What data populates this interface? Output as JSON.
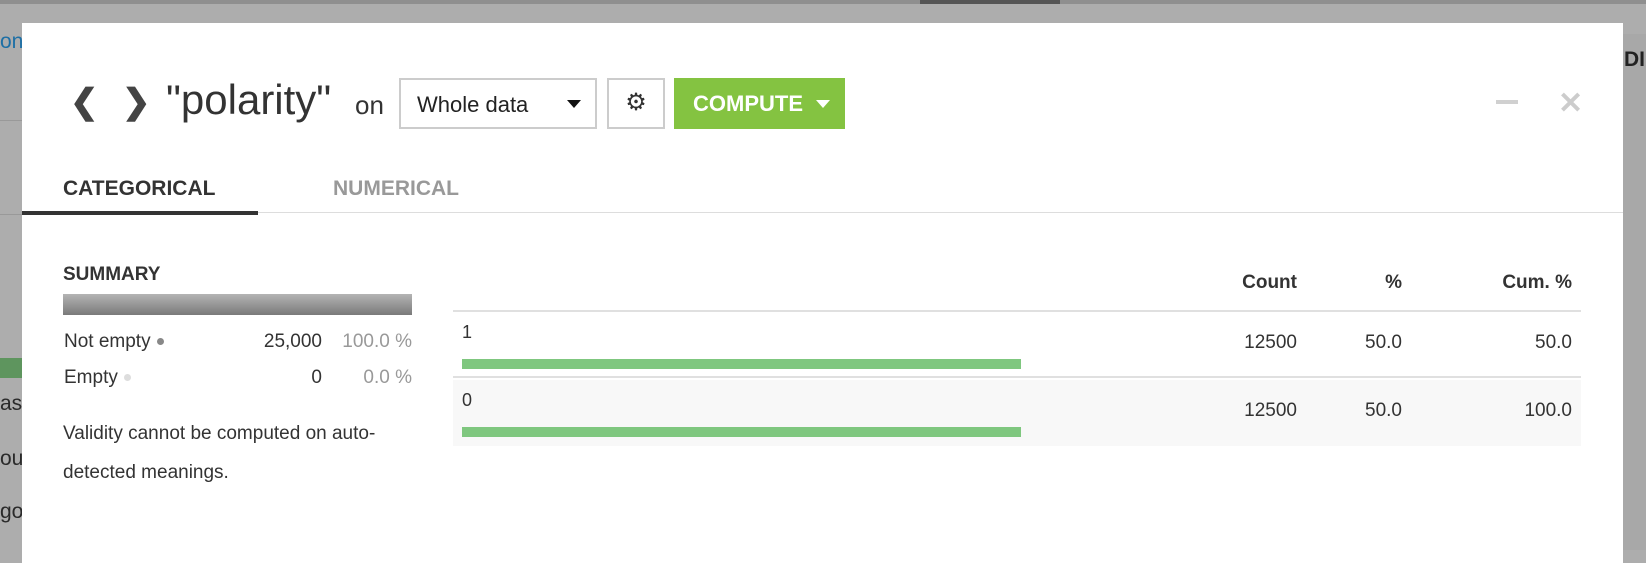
{
  "background": {
    "left_fragments": [
      "onf",
      "as",
      "ou",
      "go"
    ],
    "right_fragment": "DI"
  },
  "header": {
    "prev_icon": "chevron-left-icon",
    "next_icon": "chevron-right-icon",
    "column_title": "\"polarity\"",
    "on_label": "on",
    "sample_select": "Whole data",
    "settings_icon": "gear-icon",
    "compute_label": "COMPUTE",
    "minimize_icon": "minus-icon",
    "close_icon": "close-icon"
  },
  "tabs": [
    {
      "label": "CATEGORICAL",
      "active": true
    },
    {
      "label": "NUMERICAL",
      "active": false
    }
  ],
  "summary": {
    "title": "SUMMARY",
    "rows": [
      {
        "label": "Not empty",
        "value": "25,000",
        "pct": "100.0 %",
        "dot_color": "#888888"
      },
      {
        "label": "Empty",
        "value": "0",
        "pct": "0.0 %",
        "dot_color": "#dddddd"
      }
    ],
    "note": "Validity cannot be computed on auto-detected meanings."
  },
  "table": {
    "headers": [
      "Count",
      "%",
      "Cum. %"
    ],
    "rows": [
      {
        "value": "1",
        "count": "12500",
        "pct": "50.0",
        "cum": "50.0",
        "share": 50
      },
      {
        "value": "0",
        "count": "12500",
        "pct": "50.0",
        "cum": "100.0",
        "share": 50
      }
    ]
  },
  "colors": {
    "accent": "#84c341",
    "bar": "#7fc77f"
  }
}
